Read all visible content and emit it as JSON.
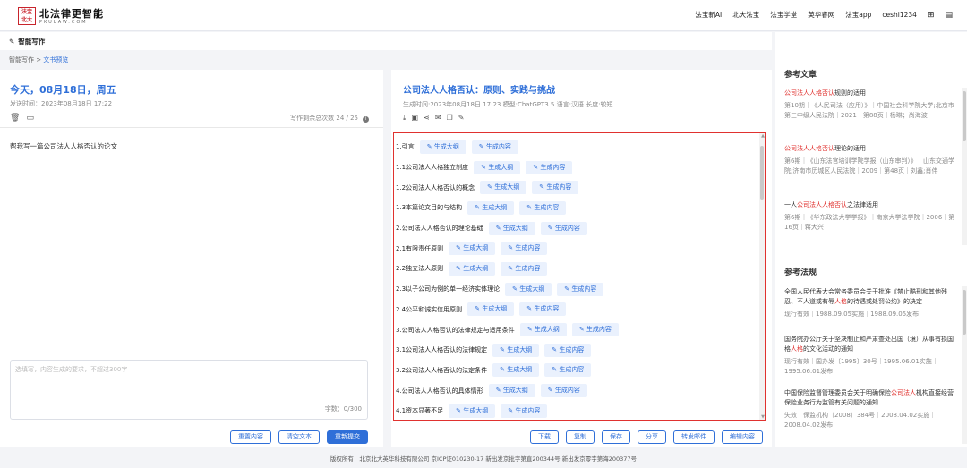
{
  "header": {
    "logo_seal": [
      "法宝",
      "北大"
    ],
    "logo_cn": "北法律更智能",
    "logo_en": "PKULAW.COM",
    "nav": [
      "法宝新AI",
      "北大法宝",
      "法宝学堂",
      "英华睿网",
      "法宝app",
      "ceshi1234"
    ],
    "nav_icons": [
      "grid-icon",
      "document-icon"
    ]
  },
  "subbar": {
    "title": "智能写作"
  },
  "breadcrumb": {
    "root": "智能写作",
    "sep": ">",
    "current": "文书预览"
  },
  "left": {
    "date": "今天，08月18日，周五",
    "sent_time": "发送时间：2023年08月18日 17:22",
    "remaining": "写作剩余总次数 24 / 25",
    "prompt": "帮我写一篇公司法人人格否认的论文",
    "input_placeholder": "选填写，内容生成的要求，不超过300字",
    "char_count": "字数：0/300",
    "buttons": [
      "重置内容",
      "清空文本",
      "重新提交"
    ]
  },
  "right": {
    "title": "公司法人人格否认：原则、实践与挑战",
    "meta": "生成时间:2023年08月18日 17:23  模型:ChatGPT3.5  语言:汉语  长度:较短",
    "gen_outline": "✎ 生成大纲",
    "gen_content": "✎ 生成内容",
    "outline": [
      "1.引言",
      "1.1公司法人人格独立制度",
      "1.2公司法人人格否认的概念",
      "1.3本篇论文目的与结构",
      "2.公司法人人格否认的理论基础",
      "2.1有限责任原则",
      "2.2独立法人原则",
      "2.3以子公司为例的单一经济实体理论",
      "2.4公平和诚实信用原则",
      "3.公司法人人格否认的法律规定与适用条件",
      "3.1公司法人人格否认的法律规定",
      "3.2公司法人人格否认的法定条件",
      "4.公司法人人格否认的具体情形",
      "4.1资本显著不足"
    ],
    "buttons": [
      "下载",
      "复制",
      "保存",
      "分享",
      "转发邮件",
      "编辑内容"
    ]
  },
  "sidebar": {
    "articles_heading": "参考文章",
    "articles": [
      {
        "pre": "",
        "hl": "公司法人人格否认",
        "post": "规则的适用",
        "src": "第10期｜《人民司法（应用）》｜中国社会科学院大学;北京市第三中级人民法院｜2021｜第88页｜杨琳；尚海波"
      },
      {
        "pre": "",
        "hl": "公司法人人格否认",
        "post": "理论的适用",
        "src": "第6期｜《山东法官培训学院学报（山东审判）》｜山东交通学院;济南市历城区人民法院｜2009｜第48页｜刘鑫;肖伟"
      },
      {
        "pre": "一人",
        "hl": "公司法人人格否认",
        "post": "之法律适用",
        "src": "第6期｜《华东政法大学学报》｜南京大学法学院｜2006｜第16页｜蒋大兴"
      }
    ],
    "laws_heading": "参考法规",
    "laws": [
      {
        "pre": "全国人民代表大会常务委员会关于批准《禁止酷刑和其他残忍、不人道或有辱",
        "hl": "人格",
        "post": "的待遇或处罚公约》的决定",
        "src": "现行有效｜1988.09.05实施｜1988.09.05发布"
      },
      {
        "pre": "国务院办公厅关于坚决制止和严肃查处出国（境）从事有损国格",
        "hl": "人格",
        "post": "的文化活动的通知",
        "src": "现行有效｜国办发〔1995〕30号｜1995.06.01实施｜1995.06.01发布"
      },
      {
        "pre": "中国保险监督管理委员会关于明确保险",
        "hl": "公司法人",
        "post": "机构直接经营保险业务行为监管有关问题的通知",
        "src": "失效｜保监机构〔2008〕384号｜2008.04.02实施｜2008.04.02发布"
      }
    ]
  },
  "footer": "版权所有：北京北大英华科技有限公司 京ICP证010230-17 新出发京批字第直200344号 新出发京零字第海200377号"
}
